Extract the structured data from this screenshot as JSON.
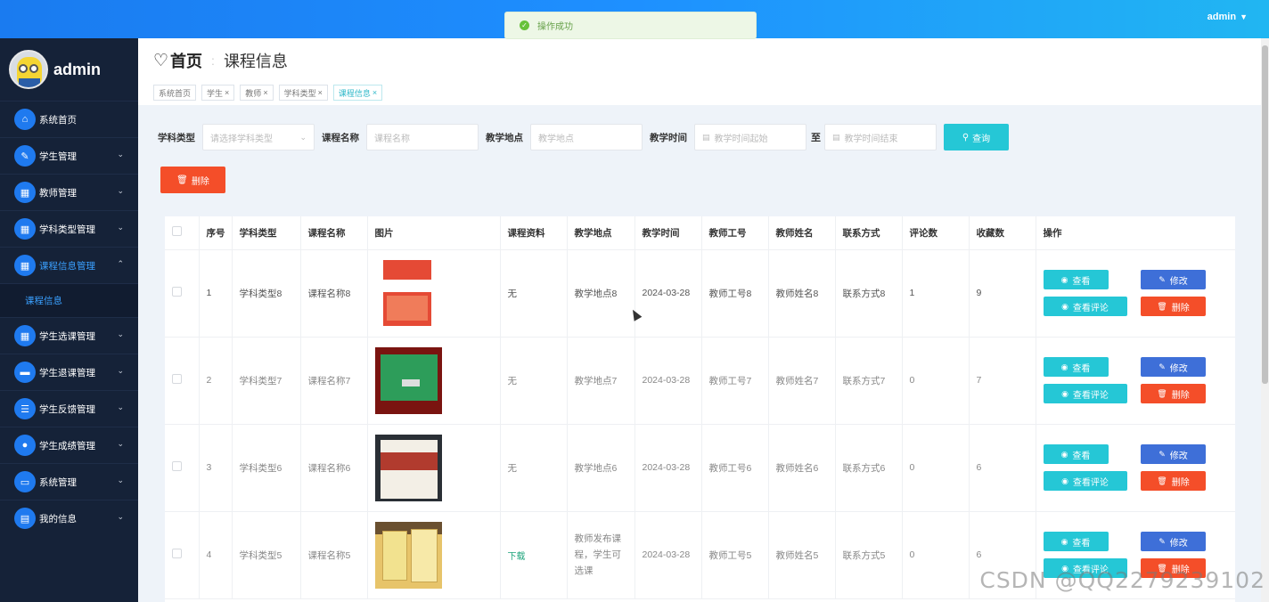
{
  "topbar": {
    "user": "admin"
  },
  "toast": {
    "message": "操作成功"
  },
  "sidebar": {
    "username": "admin",
    "items": [
      {
        "label": "系统首页",
        "icon": "home-icon"
      },
      {
        "label": "学生管理",
        "icon": "clipboard-icon"
      },
      {
        "label": "教师管理",
        "icon": "grid-icon"
      },
      {
        "label": "学科类型管理",
        "icon": "grid-icon"
      },
      {
        "label": "课程信息管理",
        "icon": "grid-icon"
      },
      {
        "label": "学生选课管理",
        "icon": "grid-icon"
      },
      {
        "label": "学生退课管理",
        "icon": "ticket-icon"
      },
      {
        "label": "学生反馈管理",
        "icon": "list-icon"
      },
      {
        "label": "学生成绩管理",
        "icon": "user-icon"
      },
      {
        "label": "系统管理",
        "icon": "monitor-icon"
      },
      {
        "label": "我的信息",
        "icon": "id-card-icon"
      }
    ],
    "submenu": "课程信息"
  },
  "header": {
    "home": "首页",
    "page_title": "课程信息",
    "tabs": [
      "系统首页",
      "学生",
      "教师",
      "学科类型",
      "课程信息"
    ]
  },
  "filter": {
    "subject_label": "学科类型",
    "subject_placeholder": "请选择学科类型",
    "course_label": "课程名称",
    "course_placeholder": "课程名称",
    "place_label": "教学地点",
    "place_placeholder": "教学地点",
    "time_label": "教学时间",
    "time_start_placeholder": "教学时间起始",
    "to": "至",
    "time_end_placeholder": "教学时间结束",
    "query": "查询"
  },
  "delete_label": "删除",
  "table": {
    "headers": [
      "序号",
      "学科类型",
      "课程名称",
      "图片",
      "课程资料",
      "教学地点",
      "教学时间",
      "教师工号",
      "教师姓名",
      "联系方式",
      "评论数",
      "收藏数",
      "操作"
    ],
    "rows": [
      {
        "no": "1",
        "subject": "学科类型8",
        "course": "课程名称8",
        "material": "无",
        "place": "教学地点8",
        "time": "2024-03-28",
        "tid": "教师工号8",
        "tname": "教师姓名8",
        "contact": "联系方式8",
        "comments": "1",
        "favs": "9"
      },
      {
        "no": "2",
        "subject": "学科类型7",
        "course": "课程名称7",
        "material": "无",
        "place": "教学地点7",
        "time": "2024-03-28",
        "tid": "教师工号7",
        "tname": "教师姓名7",
        "contact": "联系方式7",
        "comments": "0",
        "favs": "7"
      },
      {
        "no": "3",
        "subject": "学科类型6",
        "course": "课程名称6",
        "material": "无",
        "place": "教学地点6",
        "time": "2024-03-28",
        "tid": "教师工号6",
        "tname": "教师姓名6",
        "contact": "联系方式6",
        "comments": "0",
        "favs": "6"
      },
      {
        "no": "4",
        "subject": "学科类型5",
        "course": "课程名称5",
        "material": "下载",
        "place": "教师发布课程，学生可选课",
        "time": "2024-03-28",
        "tid": "教师工号5",
        "tname": "教师姓名5",
        "contact": "联系方式5",
        "comments": "0",
        "favs": "6"
      }
    ],
    "ops": {
      "view": "查看",
      "edit": "修改",
      "comment": "查看评论",
      "delete": "删除"
    }
  },
  "watermark": "CSDN @QQ2279239102"
}
